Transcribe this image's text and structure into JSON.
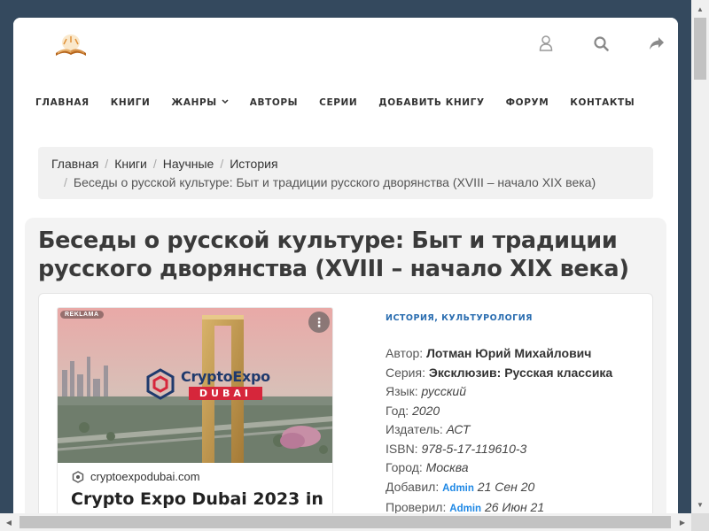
{
  "header": {
    "icons": [
      "book-logo",
      "user-icon",
      "search-icon",
      "share-icon"
    ]
  },
  "nav": [
    {
      "label": "ГЛАВНАЯ"
    },
    {
      "label": "КНИГИ"
    },
    {
      "label": "ЖАНРЫ",
      "has_dropdown": true
    },
    {
      "label": "АВТОРЫ"
    },
    {
      "label": "СЕРИИ"
    },
    {
      "label": "ДОБАВИТЬ КНИГУ"
    },
    {
      "label": "ФОРУМ"
    },
    {
      "label": "КОНТАКТЫ"
    }
  ],
  "breadcrumb": {
    "items": [
      "Главная",
      "Книги",
      "Научные",
      "История"
    ],
    "current": "Беседы о русской культуре: Быт и традиции русского дворянства (XVIII – начало XIX века)"
  },
  "book": {
    "title": "Беседы о русской культуре: Быт и традиции русского дворянства (XVIII – начало XIX века)",
    "genres": [
      "ИСТОРИЯ",
      "КУЛЬТУРОЛОГИЯ"
    ],
    "genre_separator": ", ",
    "fields": {
      "author_label": "Автор:",
      "author": "Лотман Юрий Михайлович",
      "series_label": "Серия:",
      "series": "Эксклюзив: Русская классика",
      "language_label": "Язык:",
      "language": "русский",
      "year_label": "Год:",
      "year": "2020",
      "publisher_label": "Издатель:",
      "publisher": "АСТ",
      "isbn_label": "ISBN:",
      "isbn": "978-5-17-119610-3",
      "city_label": "Город:",
      "city": "Москва",
      "added_label": "Добавил:",
      "added_by": "Admin",
      "added_date": "21 Сен 20",
      "checked_label": "Проверил:",
      "checked_by": "Admin",
      "checked_date": "26 Июн 21"
    }
  },
  "ad": {
    "badge": "REKLAMA",
    "menu_glyph": "⋮",
    "brand": "CryptoExpo",
    "brand_city": "DUBAI",
    "domain": "cryptoexpodubai.com",
    "headline": "Crypto Expo Dubai 2023 in"
  },
  "colors": {
    "background": "#34495e",
    "link": "#2a6db0",
    "admin": "#1e88e5",
    "brand_red": "#d6263b",
    "brand_navy": "#1f3a6d"
  }
}
